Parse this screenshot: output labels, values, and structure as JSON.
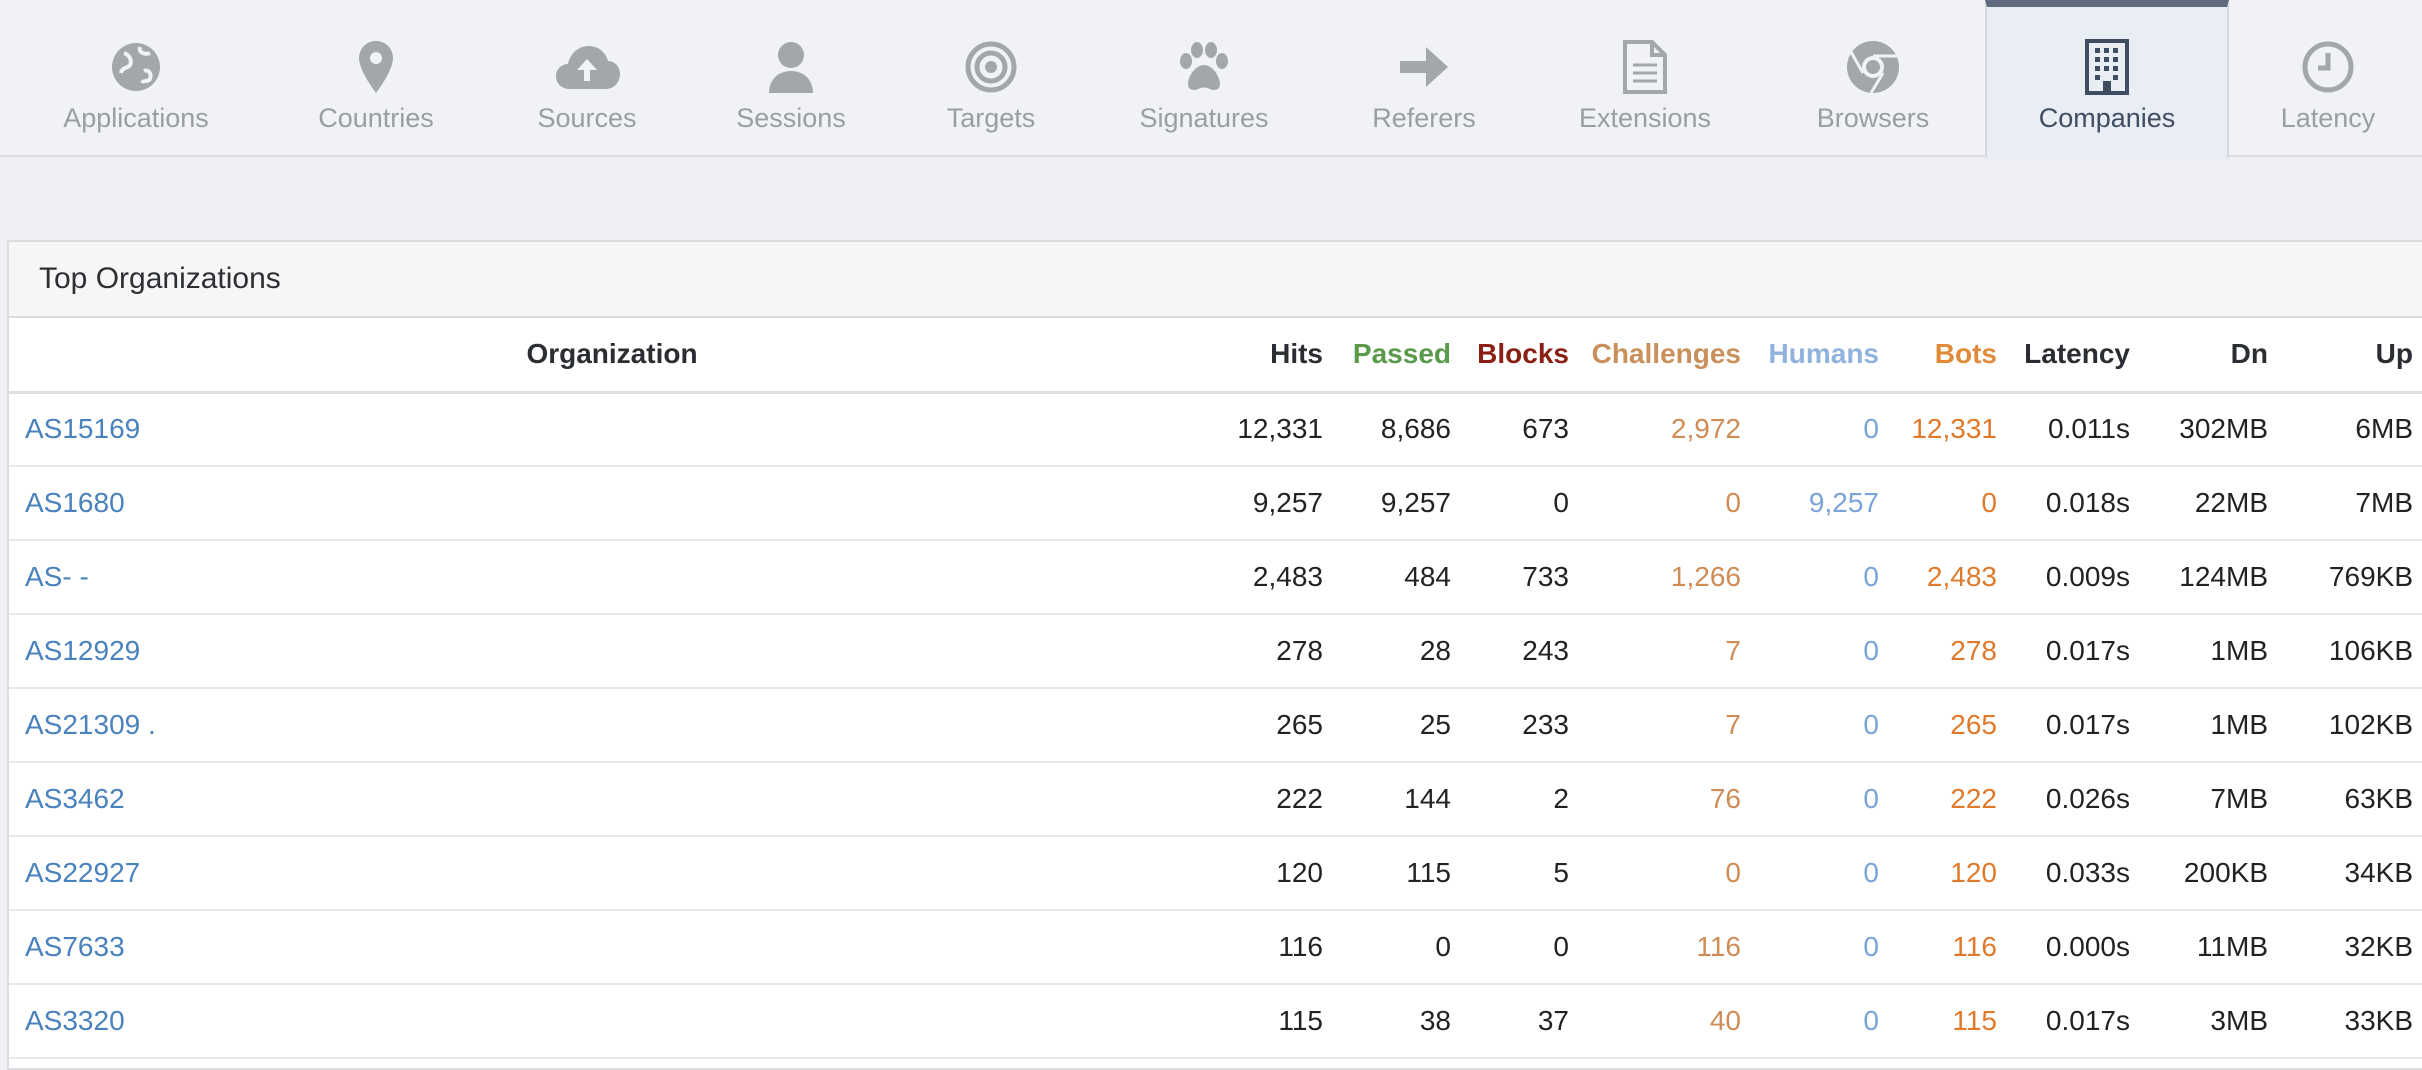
{
  "tabs": [
    {
      "label": "Applications",
      "icon": "globe-icon"
    },
    {
      "label": "Countries",
      "icon": "map-pin-icon"
    },
    {
      "label": "Sources",
      "icon": "cloud-upload-icon"
    },
    {
      "label": "Sessions",
      "icon": "user-icon"
    },
    {
      "label": "Targets",
      "icon": "target-icon"
    },
    {
      "label": "Signatures",
      "icon": "paw-icon"
    },
    {
      "label": "Referers",
      "icon": "arrow-right-icon"
    },
    {
      "label": "Extensions",
      "icon": "document-icon"
    },
    {
      "label": "Browsers",
      "icon": "chrome-icon"
    },
    {
      "label": "Companies",
      "icon": "building-icon",
      "active": true
    },
    {
      "label": "Latency",
      "icon": "clock-icon"
    }
  ],
  "panel": {
    "title": "Top Organizations",
    "columns": [
      "Organization",
      "Hits",
      "Passed",
      "Blocks",
      "Challenges",
      "Humans",
      "Bots",
      "Latency",
      "Dn",
      "Up"
    ],
    "rows": [
      [
        "AS15169",
        "12,331",
        "8,686",
        "673",
        "2,972",
        "0",
        "12,331",
        "0.011s",
        "302MB",
        "6MB"
      ],
      [
        "AS1680",
        "9,257",
        "9,257",
        "0",
        "0",
        "9,257",
        "0",
        "0.018s",
        "22MB",
        "7MB"
      ],
      [
        "AS- -",
        "2,483",
        "484",
        "733",
        "1,266",
        "0",
        "2,483",
        "0.009s",
        "124MB",
        "769KB"
      ],
      [
        "AS12929",
        "278",
        "28",
        "243",
        "7",
        "0",
        "278",
        "0.017s",
        "1MB",
        "106KB"
      ],
      [
        "AS21309 .",
        "265",
        "25",
        "233",
        "7",
        "0",
        "265",
        "0.017s",
        "1MB",
        "102KB"
      ],
      [
        "AS3462",
        "222",
        "144",
        "2",
        "76",
        "0",
        "222",
        "0.026s",
        "7MB",
        "63KB"
      ],
      [
        "AS22927",
        "120",
        "115",
        "5",
        "0",
        "0",
        "120",
        "0.033s",
        "200KB",
        "34KB"
      ],
      [
        "AS7633",
        "116",
        "0",
        "0",
        "116",
        "0",
        "116",
        "0.000s",
        "11MB",
        "32KB"
      ],
      [
        "AS3320",
        "115",
        "38",
        "37",
        "40",
        "0",
        "115",
        "0.017s",
        "3MB",
        "33KB"
      ]
    ]
  },
  "colors": {
    "passed": "#5a9a4a",
    "blocks": "#8a1f14",
    "challenges": "#c9905c",
    "humans": "#8fb2de",
    "bots": "#e08a3a",
    "link": "#4a82bd",
    "active_tab_border": "#5f6b7c"
  }
}
